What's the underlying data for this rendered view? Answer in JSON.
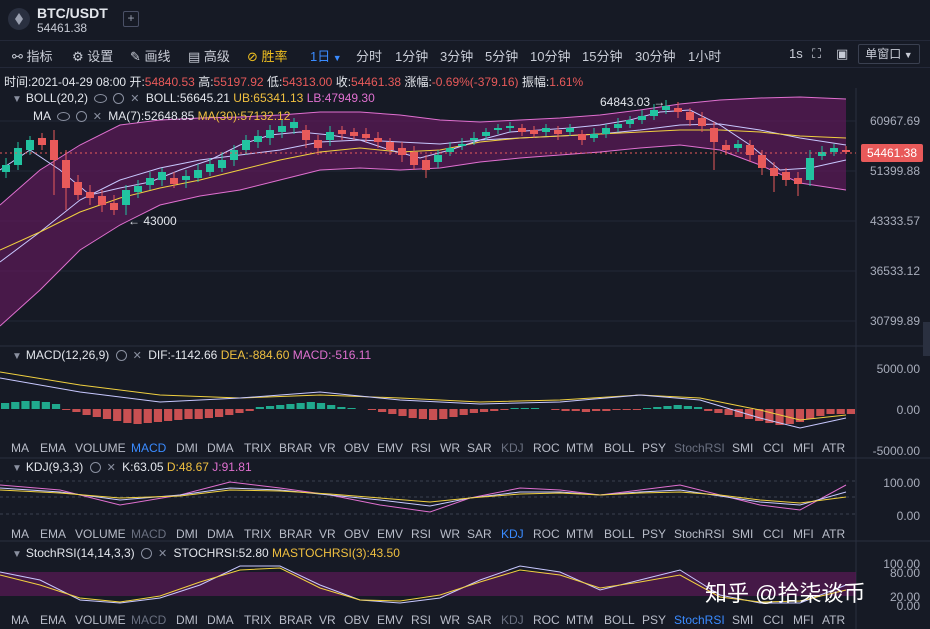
{
  "tab": {
    "symbol": "BTC/USDT",
    "price": "54461.38",
    "add": "+"
  },
  "toolbar": {
    "indicators": "指标",
    "settings": "设置",
    "draw": "画线",
    "advanced": "高级",
    "winrate": "胜率",
    "interval": "1日",
    "tick": "分时",
    "m1": "1分钟",
    "m3": "3分钟",
    "m5": "5分钟",
    "m10": "10分钟",
    "m15": "15分钟",
    "m30": "30分钟",
    "h1": "1小时",
    "sec": "1s",
    "layout": "单窗口"
  },
  "ohlc": {
    "time_l": "时间:",
    "time": "2021-04-29 08:00",
    "open_l": "开:",
    "open": "54840.53",
    "high_l": "高:",
    "high": "55197.92",
    "low_l": "低:",
    "low": "54313.00",
    "close_l": "收:",
    "close": "54461.38",
    "chg_l": "涨幅:",
    "chg": "-0.69%(-379.16)",
    "amp_l": "振幅:",
    "amp": "1.61%"
  },
  "boll": {
    "name": "BOLL(20,2)",
    "mid": "BOLL:56645.21",
    "ub": "UB:65341.13",
    "lb": "LB:47949.30"
  },
  "ma": {
    "name": "MA",
    "ma7": "MA(7):52648.85",
    "ma30": "MA(30):57132.12"
  },
  "main_axis": [
    "60967.69",
    "51399.88",
    "43333.57",
    "36533.12",
    "30799.89"
  ],
  "current_price": "54461.38",
  "annotations": {
    "high": "64843.03",
    "low": "43000"
  },
  "macd": {
    "name": "MACD(12,26,9)",
    "dif": "DIF:-1142.66",
    "dea": "DEA:-884.60",
    "macd": "MACD:-516.11",
    "axis": [
      "5000.00",
      "0.00",
      "-5000.00"
    ]
  },
  "kdj": {
    "name": "KDJ(9,3,3)",
    "k": "K:63.05",
    "d": "D:48.67",
    "j": "J:91.81",
    "axis": [
      "100.00",
      "0.00"
    ]
  },
  "stochrsi": {
    "name": "StochRSI(14,14,3,3)",
    "val": "STOCHRSI:52.80",
    "ma": "MASTOCHRSI(3):43.50",
    "axis": [
      "100.00",
      "80.00",
      "20.00",
      "0.00"
    ]
  },
  "indicator_tabs": [
    "MA",
    "EMA",
    "VOLUME",
    "MACD",
    "DMI",
    "DMA",
    "TRIX",
    "BRAR",
    "VR",
    "OBV",
    "EMV",
    "RSI",
    "WR",
    "SAR",
    "KDJ",
    "ROC",
    "MTM",
    "BOLL",
    "PSY",
    "StochRSI",
    "SMI",
    "CCI",
    "MFI",
    "ATR"
  ],
  "watermark": "知乎 @拾柒谈币",
  "colors": {
    "up": "#22c3a0",
    "down": "#e85a5a",
    "boll_band": "#e070d0",
    "ma7": "#c8c8ff",
    "ma30": "#f0d040"
  }
}
